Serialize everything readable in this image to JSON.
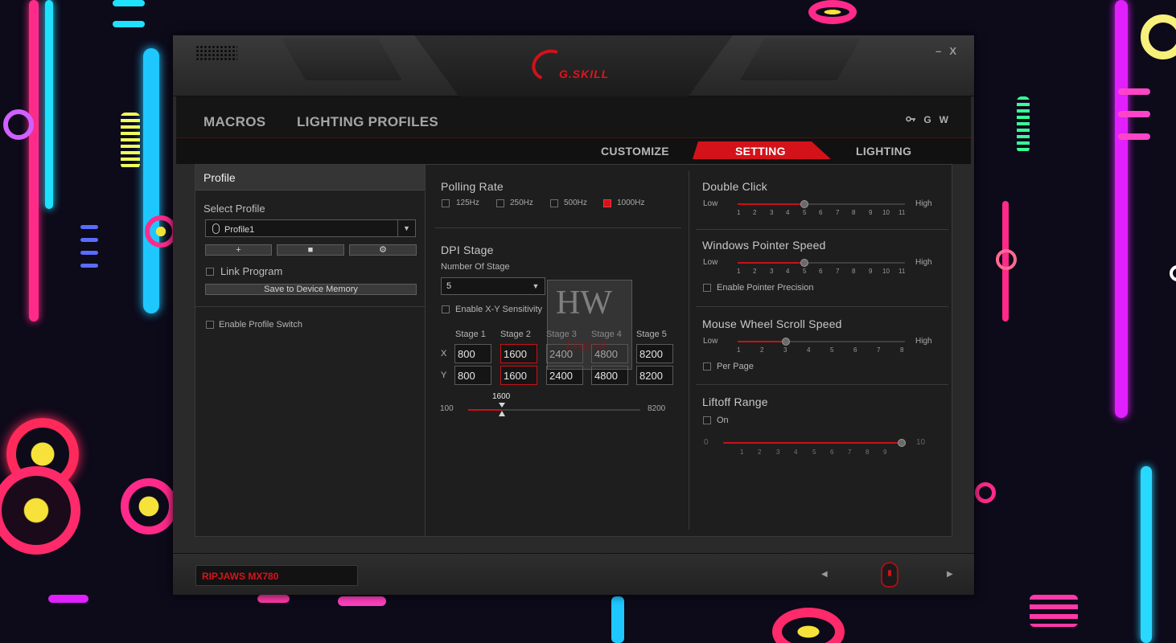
{
  "window": {
    "brand": "G.SKILL",
    "minimize": "–",
    "close": "X"
  },
  "main_nav": {
    "tabs": [
      "MACROS",
      "LIGHTING PROFILES"
    ],
    "icons": [
      "settings-icon",
      "G",
      "W"
    ],
    "icon_labels": {
      "g": "G",
      "w": "W"
    }
  },
  "sub_nav": {
    "tabs": [
      "CUSTOMIZE",
      "SETTING",
      "LIGHTING"
    ],
    "active": "SETTING"
  },
  "profile": {
    "header": "Profile",
    "select_label": "Select Profile",
    "selected": "Profile1",
    "add_button": "+",
    "delete_button": "■",
    "settings_button": "⚙",
    "link_program": "Link Program",
    "save_button": "Save to Device Memory",
    "enable_switch": "Enable Profile Switch"
  },
  "polling": {
    "title": "Polling Rate",
    "options": [
      "125Hz",
      "250Hz",
      "500Hz",
      "1000Hz"
    ],
    "selected": "1000Hz"
  },
  "dpi": {
    "title": "DPI Stage",
    "number_label": "Number Of Stage",
    "number_value": "5",
    "xy_label": "Enable X-Y Sensitivity",
    "stages": [
      "Stage 1",
      "Stage 2",
      "Stage 3",
      "Stage 4",
      "Stage 5"
    ],
    "x_label": "X",
    "y_label": "Y",
    "x_values": [
      "800",
      "1600",
      "2400",
      "4800",
      "8200"
    ],
    "y_values": [
      "800",
      "1600",
      "2400",
      "4800",
      "8200"
    ],
    "active_stage": 2,
    "slider_min": "100",
    "slider_max": "8200",
    "slider_value": "1600"
  },
  "watermark": {
    "hw": "HW",
    "legend": "Legend"
  },
  "double_click": {
    "title": "Double Click",
    "low": "Low",
    "high": "High",
    "ticks": [
      "1",
      "2",
      "3",
      "4",
      "5",
      "6",
      "7",
      "8",
      "9",
      "10",
      "11"
    ],
    "value": 5
  },
  "pointer_speed": {
    "title": "Windows Pointer Speed",
    "low": "Low",
    "high": "High",
    "ticks": [
      "1",
      "2",
      "3",
      "4",
      "5",
      "6",
      "7",
      "8",
      "9",
      "10",
      "11"
    ],
    "value": 5,
    "precision": "Enable Pointer Precision"
  },
  "scroll_speed": {
    "title": "Mouse Wheel Scroll Speed",
    "low": "Low",
    "high": "High",
    "ticks": [
      "1",
      "2",
      "3",
      "4",
      "5",
      "6",
      "7",
      "8"
    ],
    "value": 3,
    "per_page": "Per Page"
  },
  "liftoff": {
    "title": "Liftoff Range",
    "on": "On",
    "min": "0",
    "max": "10",
    "ticks": [
      "1",
      "2",
      "3",
      "4",
      "5",
      "6",
      "7",
      "8",
      "9"
    ],
    "value": 10
  },
  "footer": {
    "device": "RIPJAWS MX780",
    "prev": "◀",
    "next": "▶"
  },
  "colors": {
    "accent": "#d3121a",
    "panel": "#1f1f1f"
  }
}
